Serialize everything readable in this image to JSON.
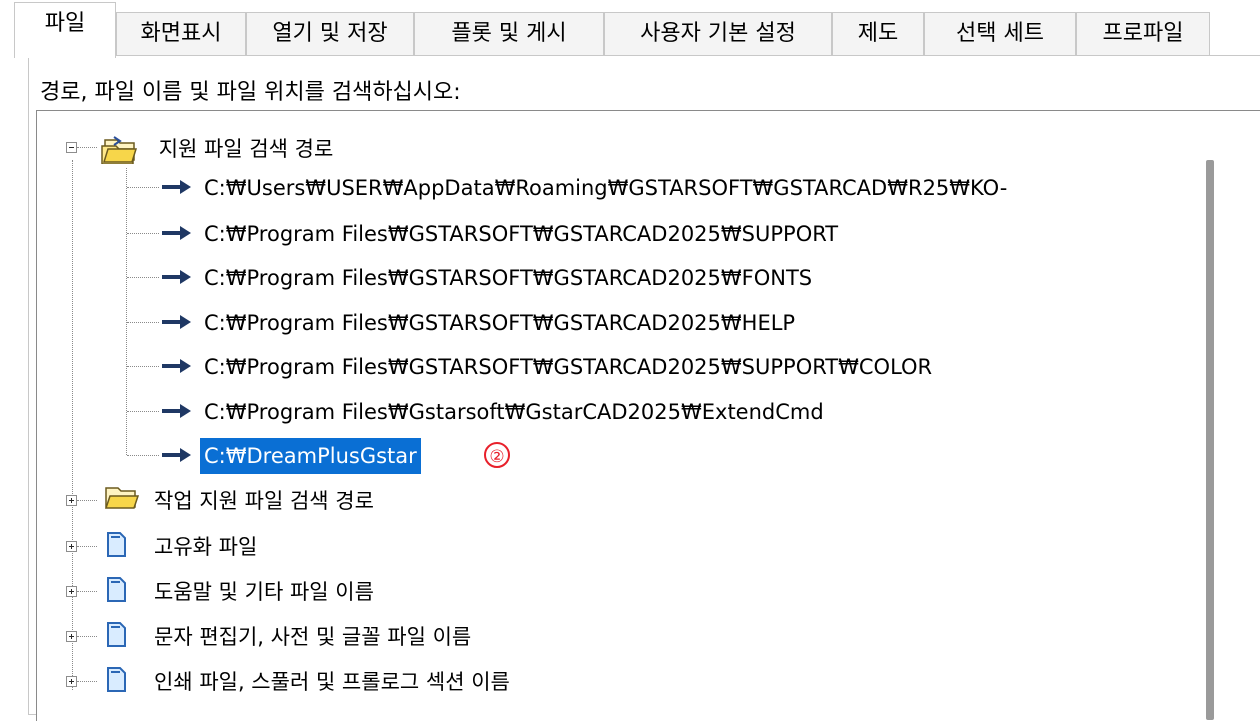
{
  "tabs": [
    {
      "label": "파일",
      "active": true
    },
    {
      "label": "화면표시"
    },
    {
      "label": "열기 및 저장"
    },
    {
      "label": "플롯 및 게시"
    },
    {
      "label": "사용자 기본 설정"
    },
    {
      "label": "제도"
    },
    {
      "label": "선택 세트"
    },
    {
      "label": "프로파일"
    }
  ],
  "prompt": "경로, 파일 이름 및 파일 위치를 검색하십시오:",
  "tree": {
    "support_search": {
      "label": "지원 파일 검색 경로",
      "icon": "folder-open-icon",
      "expanded": true,
      "children": [
        "C:₩Users₩USER₩AppData₩Roaming₩GSTARSOFT₩GSTARCAD₩R25₩KO-",
        "C:₩Program Files₩GSTARSOFT₩GSTARCAD2025₩SUPPORT",
        "C:₩Program Files₩GSTARSOFT₩GSTARCAD2025₩FONTS",
        "C:₩Program Files₩GSTARSOFT₩GSTARCAD2025₩HELP",
        "C:₩Program Files₩GSTARSOFT₩GSTARCAD2025₩SUPPORT₩COLOR",
        "C:₩Program Files₩Gstarsoft₩GstarCAD2025₩ExtendCmd",
        "C:₩DreamPlusGstar"
      ],
      "selected_index": 6
    },
    "collapsed_items": [
      {
        "label": "작업 지원 파일 검색 경로",
        "icon": "folder-open-icon"
      },
      {
        "label": "고유화 파일",
        "icon": "file-icon"
      },
      {
        "label": "도움말 및 기타 파일 이름",
        "icon": "file-icon"
      },
      {
        "label": "문자 편집기, 사전 및 글꼴 파일 이름",
        "icon": "file-icon"
      },
      {
        "label": "인쇄 파일, 스풀러 및 프롤로그 섹션 이름",
        "icon": "file-icon"
      }
    ]
  },
  "annotation": "②",
  "colors": {
    "selection": "#0a6fd4",
    "annotation": "#e8202b",
    "arrow": "#1f3864"
  }
}
